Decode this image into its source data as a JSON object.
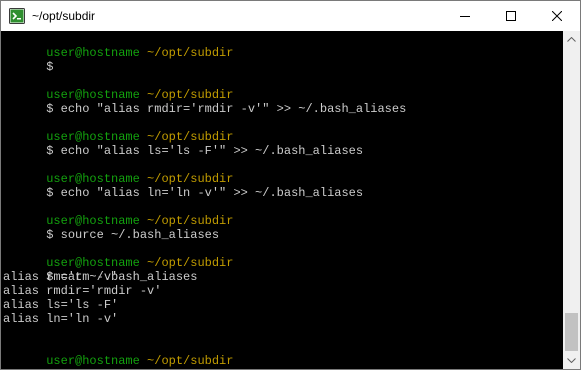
{
  "window": {
    "title": "~/opt/subdir",
    "app_icon": "terminal-app-icon",
    "controls": {
      "minimize_icon": "minimize-icon",
      "maximize_icon": "maximize-icon",
      "close_icon": "close-icon"
    }
  },
  "terminal": {
    "colors": {
      "background": "#000000",
      "text": "#cccccc",
      "user": "#13a10e",
      "path": "#c19c00"
    },
    "prompt_user": "user@hostname",
    "prompt_path": "~/opt/subdir",
    "prompt_symbol": "$",
    "commands": [
      "",
      "echo \"alias rmdir='rmdir -v'\" >> ~/.bash_aliases",
      "echo \"alias ls='ls -F'\" >> ~/.bash_aliases",
      "echo \"alias ln='ln -v'\" >> ~/.bash_aliases",
      "source ~/.bash_aliases",
      "cat ~/.bash_aliases",
      ""
    ],
    "output": [
      "alias rm='rm -v'",
      "alias rmdir='rmdir -v'",
      "alias ls='ls -F'",
      "alias ln='ln -v'"
    ]
  },
  "scrollbar": {
    "up_icon": "scroll-up-arrow-icon",
    "down_icon": "scroll-down-arrow-icon"
  }
}
